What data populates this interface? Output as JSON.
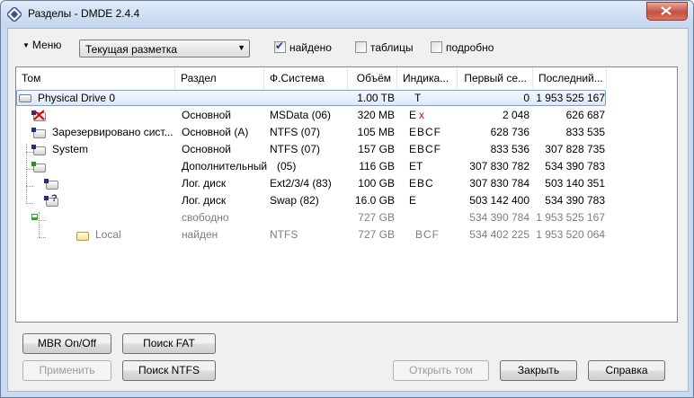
{
  "window": {
    "title": "Разделы - DMDE 2.4.4"
  },
  "toolbar": {
    "menu_label": "Меню",
    "view_select": "Текущая разметка",
    "found": {
      "label": "найдено",
      "checked": true
    },
    "tables": {
      "label": "таблицы",
      "checked": false
    },
    "detailed": {
      "label": "подробно",
      "checked": false
    }
  },
  "table": {
    "columns": [
      "Том",
      "Раздел",
      "Ф.Система",
      "Объём",
      "Индика...",
      "Первый се...",
      "Последний..."
    ],
    "rows": [
      {
        "volume": "Physical Drive 0",
        "section": "",
        "fs": "",
        "size": "1.00 TB",
        "indic": "T",
        "first": "0",
        "last": "1 953 525 167"
      },
      {
        "volume": "",
        "section": "Основной",
        "fs": "MSData (06)",
        "size": "320 MB",
        "indic": "E",
        "indic_red": "x",
        "first": "2 048",
        "last": "626 687"
      },
      {
        "volume": "Зарезервировано сист...",
        "section": "Основной (A)",
        "fs": "NTFS (07)",
        "size": "105 MB",
        "indic": "EBCF",
        "first": "628 736",
        "last": "833 535"
      },
      {
        "volume": "System",
        "section": "Основной",
        "fs": "NTFS (07)",
        "size": "157 GB",
        "indic": "EBCF",
        "first": "833 536",
        "last": "307 828 735"
      },
      {
        "volume": "",
        "section": "Дополнительный",
        "fs": "(05)",
        "size": "116 GB",
        "indic": "ET",
        "first": "307 830 782",
        "last": "534 390 783"
      },
      {
        "volume": "",
        "section": "Лог. диск",
        "fs": "Ext2/3/4 (83)",
        "size": "100 GB",
        "indic": "EBC",
        "first": "307 830 784",
        "last": "503 140 351"
      },
      {
        "volume": "",
        "section": "Лог. диск",
        "fs": "Swap (82)",
        "size": "16.0 GB",
        "indic": "E",
        "first": "503 142 400",
        "last": "534 390 783"
      },
      {
        "volume": "",
        "section": "свободно",
        "fs": "",
        "size": "727 GB",
        "indic": "",
        "first": "534 390 784",
        "last": "1 953 525 167"
      },
      {
        "volume": "Local",
        "section": "найден",
        "fs": "NTFS",
        "size": "727 GB",
        "indic": "BCF",
        "first": "534 402 225",
        "last": "1 953 520 064"
      }
    ]
  },
  "buttons": {
    "mbr": "MBR On/Off",
    "fat": "Поиск FAT",
    "ntfs": "Поиск NTFS",
    "apply": "Применить",
    "open": "Открыть том",
    "close": "Закрыть",
    "help": "Справка"
  },
  "colors": {
    "selection": "#dce9f7",
    "indicator_error": "#e00000",
    "free_gray": "#7d7d7d"
  }
}
